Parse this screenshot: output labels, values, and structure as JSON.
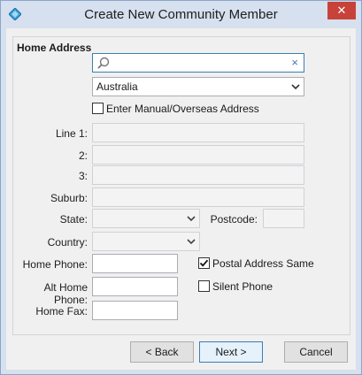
{
  "window": {
    "title": "Create New Community Member",
    "close_symbol": "✕"
  },
  "group": {
    "title": "Home Address"
  },
  "search": {
    "value": "",
    "clear_symbol": "×"
  },
  "address": {
    "country_lookup": "Australia",
    "manual_label": "Enter Manual/Overseas Address",
    "manual_checked": false,
    "line1_label": "Line 1:",
    "line2_label": "2:",
    "line3_label": "3:",
    "suburb_label": "Suburb:",
    "state_label": "State:",
    "postcode_label": "Postcode:",
    "country_label": "Country:"
  },
  "phones": {
    "home_label": "Home Phone:",
    "alt_label": "Alt Home Phone:",
    "fax_label": "Home Fax:",
    "postal_same_label": "Postal Address Same",
    "postal_same_checked": true,
    "silent_label": "Silent Phone",
    "silent_checked": false
  },
  "footer": {
    "back_label": "< Back",
    "next_label": "Next >",
    "cancel_label": "Cancel"
  }
}
